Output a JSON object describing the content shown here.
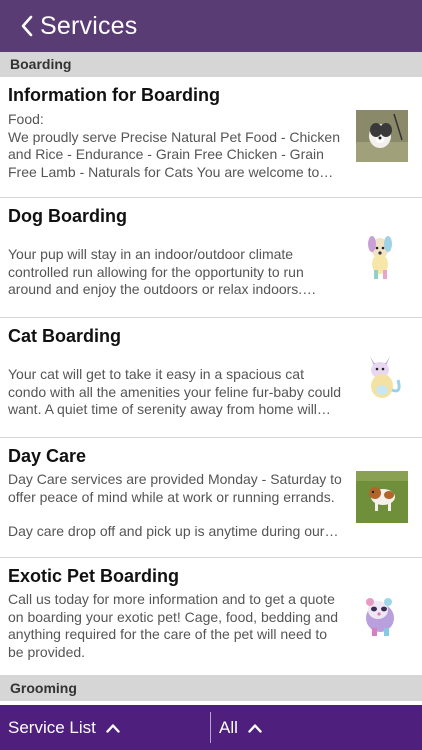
{
  "header": {
    "title": "Services",
    "back_icon": "chevron-left-icon"
  },
  "sections": [
    {
      "label": "Boarding"
    },
    {
      "label": "Grooming"
    }
  ],
  "items": [
    {
      "title": "Information for Boarding",
      "desc1": "Food:",
      "desc2": "We proudly serve Precise Natural Pet Food - Chicken and Rice - Endurance - Grain Free Chicken - Grain Free Lamb - Naturals for Cats You are welcome to b…"
    },
    {
      "title": "Dog Boarding",
      "desc1": "",
      "desc2": "Your pup will stay in an indoor/outdoor climate controlled run allowing for the opportunity to run around and enjoy the outdoors or relax indoors.…"
    },
    {
      "title": "Cat Boarding",
      "desc1": "",
      "desc2": "Your cat will get to take it easy in a spacious cat condo with all the amenities your feline fur-baby could want. A quiet time of serenity away from home will leave your…"
    },
    {
      "title": "Day Care",
      "desc1": "Day Care services are provided Monday - Saturday to offer peace of mind while at work or running errands.",
      "desc2": "Day care drop off and pick up is anytime during our…"
    },
    {
      "title": "Exotic Pet Boarding",
      "desc1": "",
      "desc2": "Call us today for more information and to get a quote on boarding your exotic pet! Cage, food, bedding and anything required for the care of the pet will need to be provided."
    }
  ],
  "footer": {
    "service_list": "Service List",
    "filter": "All",
    "chevron_icon": "chevron-up-icon"
  },
  "colors": {
    "header": "#5a3c74",
    "footer": "#4e1f7c",
    "section": "#d6d6d6"
  }
}
